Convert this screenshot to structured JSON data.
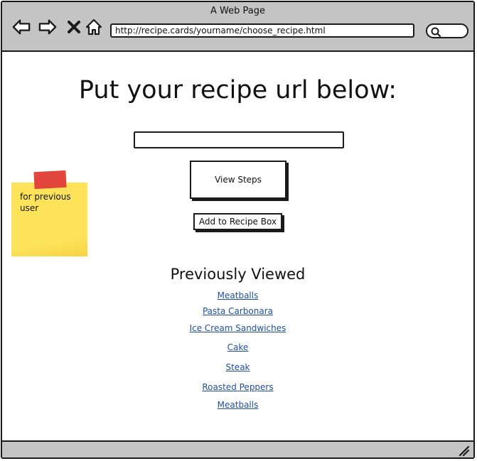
{
  "window": {
    "title": "A Web Page"
  },
  "browser": {
    "url": "http://recipe.cards/yourname/choose_recipe.html",
    "icons": [
      "back-arrow-icon",
      "forward-arrow-icon",
      "close-x-icon",
      "home-icon",
      "search-icon",
      "resize-grip-icon"
    ]
  },
  "main": {
    "heading": "Put your recipe url below:",
    "url_input_value": "",
    "view_steps_label": "View Steps",
    "add_to_box_label": "Add to Recipe Box"
  },
  "sticky_note": {
    "text": "for previous user",
    "color": "#fde35a",
    "tape_color": "#e2453c"
  },
  "previously_viewed": {
    "heading": "Previously Viewed",
    "items": [
      "Meatballs",
      "Pasta Carbonara",
      "Ice Cream Sandwiches",
      "Cake",
      "Steak",
      "Roasted Peppers",
      "Meatballs"
    ]
  },
  "colors": {
    "chrome": "#c4c4c4",
    "link": "#1f4fa0",
    "border": "#1a1a1a"
  }
}
